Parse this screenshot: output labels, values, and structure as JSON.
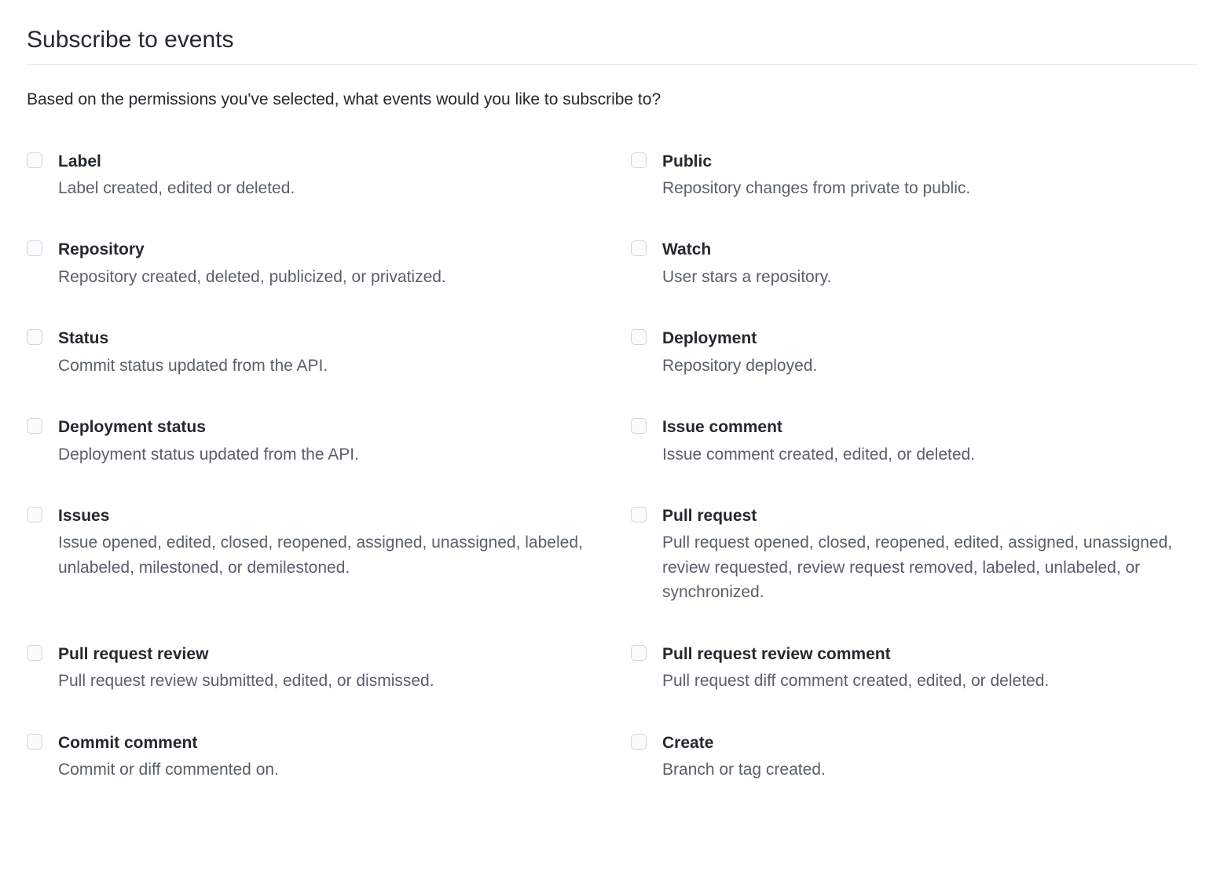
{
  "section": {
    "title": "Subscribe to events",
    "description": "Based on the permissions you've selected, what events would you like to subscribe to?"
  },
  "events": {
    "left": [
      {
        "title": "Label",
        "desc": "Label created, edited or deleted."
      },
      {
        "title": "Repository",
        "desc": "Repository created, deleted, publicized, or privatized."
      },
      {
        "title": "Status",
        "desc": "Commit status updated from the API."
      },
      {
        "title": "Deployment status",
        "desc": "Deployment status updated from the API."
      },
      {
        "title": "Issues",
        "desc": "Issue opened, edited, closed, reopened, assigned, unassigned, labeled, unlabeled, milestoned, or demilestoned."
      },
      {
        "title": "Pull request review",
        "desc": "Pull request review submitted, edited, or dismissed."
      },
      {
        "title": "Commit comment",
        "desc": "Commit or diff commented on."
      }
    ],
    "right": [
      {
        "title": "Public",
        "desc": "Repository changes from private to public."
      },
      {
        "title": "Watch",
        "desc": "User stars a repository."
      },
      {
        "title": "Deployment",
        "desc": "Repository deployed."
      },
      {
        "title": "Issue comment",
        "desc": "Issue comment created, edited, or deleted."
      },
      {
        "title": "Pull request",
        "desc": "Pull request opened, closed, reopened, edited, assigned, unassigned, review requested, review request removed, labeled, unlabeled, or synchronized."
      },
      {
        "title": "Pull request review comment",
        "desc": "Pull request diff comment created, edited, or deleted."
      },
      {
        "title": "Create",
        "desc": "Branch or tag created."
      }
    ]
  }
}
